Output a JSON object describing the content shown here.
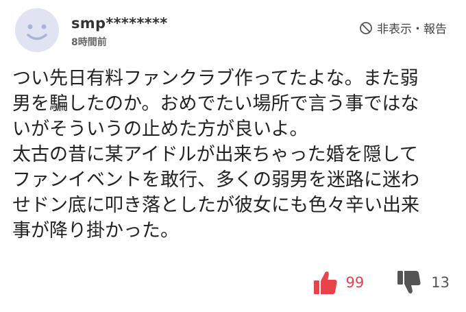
{
  "comment": {
    "username": "smp********",
    "time": "8時間前",
    "actions_label": "非表示・報告",
    "body_lines": [
      "つい先日有料ファンクラブ作ってたよな。また弱",
      "男を騙したのか。おめでたい場所で言う事ではな",
      "いがそういうの止めた方が良いよ。",
      "太古の昔に某アイドルが出来ちゃった婚を隠して",
      "ファンイベントを敢行、多くの弱男を迷路に迷わ",
      "せドン底に叩き落としたが彼女にも色々辛い出来",
      "事が降り掛かった。"
    ],
    "likes": "99",
    "dislikes": "13"
  },
  "colors": {
    "like": "#e8424a",
    "dislike": "#555555",
    "avatar_bg": "#dfe3f2",
    "avatar_face": "#a9b4d8"
  },
  "icons": {
    "avatar": "smiley-avatar-icon",
    "hide": "ban-icon",
    "like": "thumbs-up-icon",
    "dislike": "thumbs-down-icon"
  }
}
